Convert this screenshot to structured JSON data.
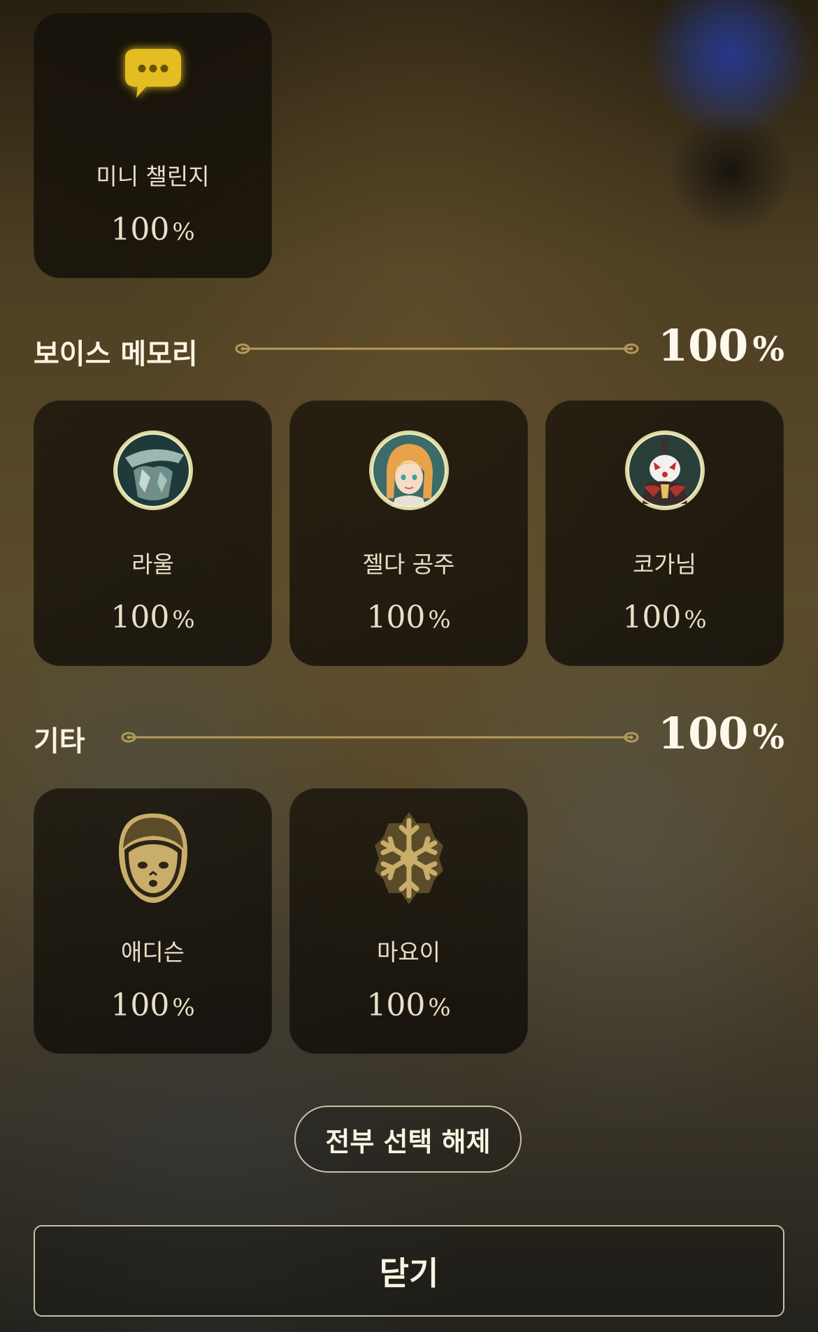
{
  "top_card": {
    "label": "미니 챌린지",
    "percent": "100",
    "unit": "%",
    "icon": "speech-bubble-icon"
  },
  "voice_memory": {
    "title": "보이스 메모리",
    "percent": "100",
    "unit": "%",
    "cards": [
      {
        "label": "라울",
        "percent": "100",
        "unit": "%",
        "icon": "rauru-portrait-icon"
      },
      {
        "label": "젤다 공주",
        "percent": "100",
        "unit": "%",
        "icon": "zelda-portrait-icon"
      },
      {
        "label": "코가님",
        "percent": "100",
        "unit": "%",
        "icon": "master-kohga-portrait-icon"
      }
    ]
  },
  "etc": {
    "title": "기타",
    "percent": "100",
    "unit": "%",
    "cards": [
      {
        "label": "애디슨",
        "percent": "100",
        "unit": "%",
        "icon": "addison-face-icon"
      },
      {
        "label": "마요이",
        "percent": "100",
        "unit": "%",
        "icon": "snowflake-icon"
      }
    ]
  },
  "buttons": {
    "deselect_all": "전부 선택 해제",
    "close": "닫기"
  },
  "colors": {
    "gold_line": "#b49a5a",
    "text_light": "#e9e0c8",
    "icon_gold": "#e8c22a"
  }
}
